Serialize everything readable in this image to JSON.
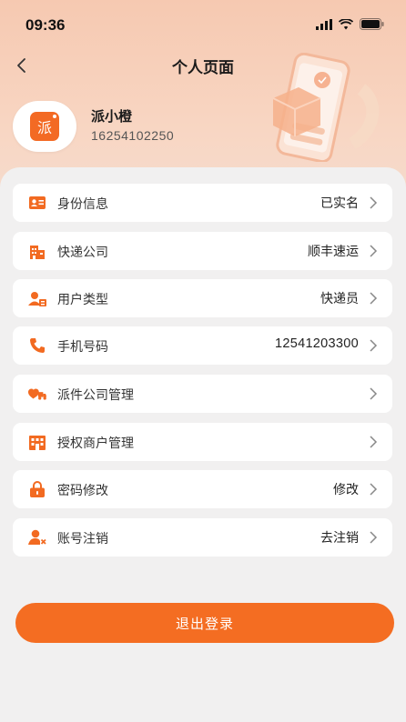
{
  "status_bar": {
    "time": "09:36"
  },
  "nav": {
    "title": "个人页面"
  },
  "profile": {
    "avatar_text": "派",
    "name": "派小橙",
    "phone": "16254102250"
  },
  "menu": [
    {
      "icon": "id-card-icon",
      "label": "身份信息",
      "value": "已实名"
    },
    {
      "icon": "building-icon",
      "label": "快递公司",
      "value": "顺丰速运"
    },
    {
      "icon": "users-icon",
      "label": "用户类型",
      "value": "快递员"
    },
    {
      "icon": "phone-icon",
      "label": "手机号码",
      "value": "12541203300"
    },
    {
      "icon": "truck-heart-icon",
      "label": "派件公司管理",
      "value": ""
    },
    {
      "icon": "store-icon",
      "label": "授权商户管理",
      "value": ""
    },
    {
      "icon": "lock-icon",
      "label": "密码修改",
      "value": "修改"
    },
    {
      "icon": "user-remove-icon",
      "label": "账号注销",
      "value": "去注销"
    }
  ],
  "logout_label": "退出登录",
  "colors": {
    "accent": "#f46d22",
    "header_bg": "#f6c9b1",
    "icon": "#f26a21"
  }
}
